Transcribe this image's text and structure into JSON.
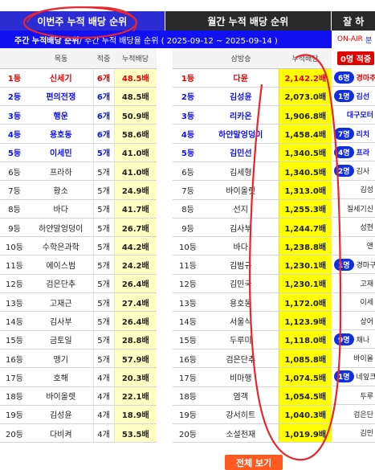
{
  "tabs": {
    "weekly": "이번주 누적 배당 순위",
    "monthly": "월간 누적 배당 순위",
    "third": "잘 하"
  },
  "subbar": {
    "strong": "주간 누적배당 순위",
    "rest": " / 주간 누적 배당율 순위 ( 2025-09-12 ~ 2025-09-14 )"
  },
  "onair": {
    "label": "ON-AIR",
    "extra": "분"
  },
  "weekly_headers": [
    "",
    "목동",
    "적중",
    "누적배당"
  ],
  "weekly_rows": [
    {
      "rank": "1등",
      "name": "신세기",
      "count": "6개",
      "value": "48.5배",
      "style": "red"
    },
    {
      "rank": "2등",
      "name": "편의전쟁",
      "count": "6개",
      "value": "48.5배",
      "style": "blue"
    },
    {
      "rank": "3등",
      "name": "행운",
      "count": "6개",
      "value": "50.9배",
      "style": "blue"
    },
    {
      "rank": "4등",
      "name": "용호동",
      "count": "6개",
      "value": "58.6배",
      "style": "blue"
    },
    {
      "rank": "5등",
      "name": "이세민",
      "count": "5개",
      "value": "41.0배",
      "style": "blue"
    },
    {
      "rank": "6등",
      "name": "프라하",
      "count": "5개",
      "value": "41.0배",
      "style": ""
    },
    {
      "rank": "7등",
      "name": "황소",
      "count": "5개",
      "value": "24.9배",
      "style": ""
    },
    {
      "rank": "8등",
      "name": "바다",
      "count": "5개",
      "value": "41.7배",
      "style": ""
    },
    {
      "rank": "9등",
      "name": "하얀말엉덩이",
      "count": "5개",
      "value": "26.7배",
      "style": ""
    },
    {
      "rank": "10등",
      "name": "수학은과학",
      "count": "5개",
      "value": "44.2배",
      "style": ""
    },
    {
      "rank": "11등",
      "name": "에이스범",
      "count": "5개",
      "value": "24.2배",
      "style": ""
    },
    {
      "rank": "12등",
      "name": "검은단추",
      "count": "5개",
      "value": "26.4배",
      "style": ""
    },
    {
      "rank": "13등",
      "name": "고재근",
      "count": "5개",
      "value": "27.4배",
      "style": ""
    },
    {
      "rank": "14등",
      "name": "김사부",
      "count": "5개",
      "value": "26.4배",
      "style": ""
    },
    {
      "rank": "15등",
      "name": "금토일",
      "count": "5개",
      "value": "28.8배",
      "style": ""
    },
    {
      "rank": "16등",
      "name": "맹기",
      "count": "5개",
      "value": "57.9배",
      "style": ""
    },
    {
      "rank": "17등",
      "name": "호해",
      "count": "4개",
      "value": "20.3배",
      "style": ""
    },
    {
      "rank": "18등",
      "name": "바이올렛",
      "count": "4개",
      "value": "22.1배",
      "style": ""
    },
    {
      "rank": "19등",
      "name": "김성윤",
      "count": "4개",
      "value": "18.9배",
      "style": ""
    },
    {
      "rank": "20등",
      "name": "다비켜",
      "count": "4개",
      "value": "53.5배",
      "style": ""
    }
  ],
  "monthly_headers": [
    "",
    "삼방승",
    "누적배당"
  ],
  "monthly_rows": [
    {
      "rank": "1등",
      "name": "다윤",
      "value": "2,142.2배",
      "style": "red"
    },
    {
      "rank": "2등",
      "name": "김성윤",
      "value": "2,073.0배",
      "style": "blue"
    },
    {
      "rank": "3등",
      "name": "리카온",
      "value": "1,906.8배",
      "style": "blue"
    },
    {
      "rank": "4등",
      "name": "하얀말엉덩이",
      "value": "1,458.4배",
      "style": "blue"
    },
    {
      "rank": "5등",
      "name": "김민선",
      "value": "1,340.5배",
      "style": "blue"
    },
    {
      "rank": "6등",
      "name": "김세형",
      "value": "1,340.5배",
      "style": ""
    },
    {
      "rank": "7등",
      "name": "바이올렛",
      "value": "1,313.0배",
      "style": ""
    },
    {
      "rank": "8등",
      "name": "선지",
      "value": "1,255.3배",
      "style": ""
    },
    {
      "rank": "9등",
      "name": "김사부",
      "value": "1,244.7배",
      "style": ""
    },
    {
      "rank": "10등",
      "name": "바다",
      "value": "1,238.8배",
      "style": ""
    },
    {
      "rank": "11등",
      "name": "김범규",
      "value": "1,230.1배",
      "style": ""
    },
    {
      "rank": "12등",
      "name": "김민국",
      "value": "1,230.1배",
      "style": ""
    },
    {
      "rank": "13등",
      "name": "용호동",
      "value": "1,172.0배",
      "style": ""
    },
    {
      "rank": "14등",
      "name": "서울식",
      "value": "1,123.9배",
      "style": ""
    },
    {
      "rank": "15등",
      "name": "두루미",
      "value": "1,118.0배",
      "style": ""
    },
    {
      "rank": "16등",
      "name": "검은단추",
      "value": "1,085.8배",
      "style": ""
    },
    {
      "rank": "17등",
      "name": "비마행",
      "value": "1,074.5배",
      "style": ""
    },
    {
      "rank": "18등",
      "name": "염객",
      "value": "1,054.5배",
      "style": ""
    },
    {
      "rank": "19등",
      "name": "강서히트",
      "value": "1,040.3배",
      "style": ""
    },
    {
      "rank": "20등",
      "name": "소설천재",
      "value": "1,019.9배",
      "style": ""
    }
  ],
  "side_top": "0명 적중",
  "side_rows": [
    {
      "pill": "6명",
      "name": "경마추",
      "style": "red"
    },
    {
      "pill": "1명",
      "name": "김선",
      "style": "blue"
    },
    {
      "pill": "",
      "name": "대구모터",
      "style": "blue"
    },
    {
      "pill": "7명",
      "name": "리치",
      "style": "blue"
    },
    {
      "pill": "4명",
      "name": "프라",
      "style": "blue"
    },
    {
      "pill": "2명",
      "name": "김사",
      "style": ""
    },
    {
      "pill": "",
      "name": "김성",
      "style": ""
    },
    {
      "pill": "",
      "name": "질세기신",
      "style": ""
    },
    {
      "pill": "",
      "name": "성현",
      "style": ""
    },
    {
      "pill": "",
      "name": "앤",
      "style": ""
    },
    {
      "pill": "1명",
      "name": "경마구력",
      "style": ""
    },
    {
      "pill": "",
      "name": "고재",
      "style": ""
    },
    {
      "pill": "",
      "name": "이세",
      "style": ""
    },
    {
      "pill": "",
      "name": "상어",
      "style": ""
    },
    {
      "pill": "9명",
      "name": "채나",
      "style": ""
    },
    {
      "pill": "",
      "name": "바이올",
      "style": ""
    },
    {
      "pill": "1명",
      "name": "네잎크로",
      "style": ""
    },
    {
      "pill": "",
      "name": "두루",
      "style": ""
    },
    {
      "pill": "",
      "name": "검은단",
      "style": ""
    },
    {
      "pill": "",
      "name": "김민",
      "style": ""
    }
  ],
  "more_button": "전체 보기",
  "colors": {
    "blue_tab": "#2c2cd3",
    "dark_tab": "#2a2a2a",
    "sub_blue": "#1010f0",
    "highlight": "#ffff00",
    "light_yellow": "#ffffc4",
    "red": "#e00000",
    "button": "#ff5a1f"
  }
}
